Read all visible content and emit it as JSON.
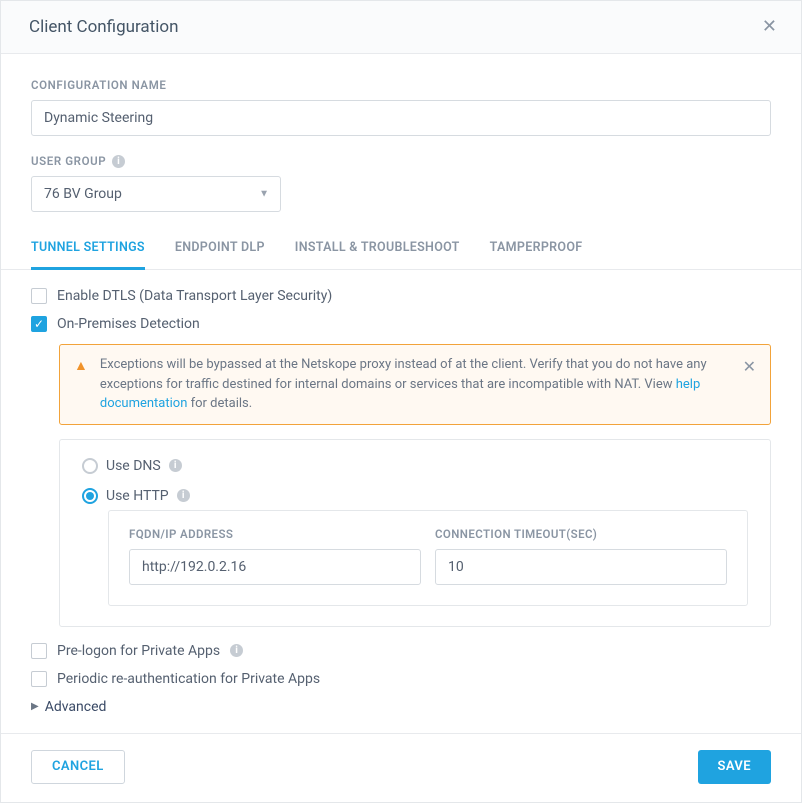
{
  "header": {
    "title": "Client Configuration"
  },
  "fields": {
    "config_name_label": "CONFIGURATION NAME",
    "config_name_value": "Dynamic Steering",
    "user_group_label": "USER GROUP",
    "user_group_value": "76 BV Group"
  },
  "tabs": [
    {
      "label": "TUNNEL SETTINGS"
    },
    {
      "label": "ENDPOINT DLP"
    },
    {
      "label": "INSTALL & TROUBLESHOOT"
    },
    {
      "label": "TAMPERPROOF"
    }
  ],
  "checkboxes": {
    "enable_dtls": "Enable DTLS (Data Transport Layer Security)",
    "on_prem": "On-Premises Detection",
    "pre_logon": "Pre-logon for Private Apps",
    "periodic_reauth": "Periodic re-authentication for Private Apps"
  },
  "alert": {
    "text_a": "Exceptions will be bypassed at the Netskope proxy instead of at the client. Verify that you do not have any exceptions for traffic destined for internal domains or services that are incompatible with NAT. View ",
    "link": "help documentation",
    "text_b": " for details."
  },
  "radios": {
    "use_dns": "Use DNS",
    "use_http": "Use HTTP"
  },
  "http_form": {
    "fqdn_label": "FQDN/IP ADDRESS",
    "fqdn_value": "http://192.0.2.16",
    "timeout_label": "CONNECTION TIMEOUT(SEC)",
    "timeout_value": "10"
  },
  "advanced_label": "Advanced",
  "footer": {
    "cancel": "CANCEL",
    "save": "SAVE"
  }
}
